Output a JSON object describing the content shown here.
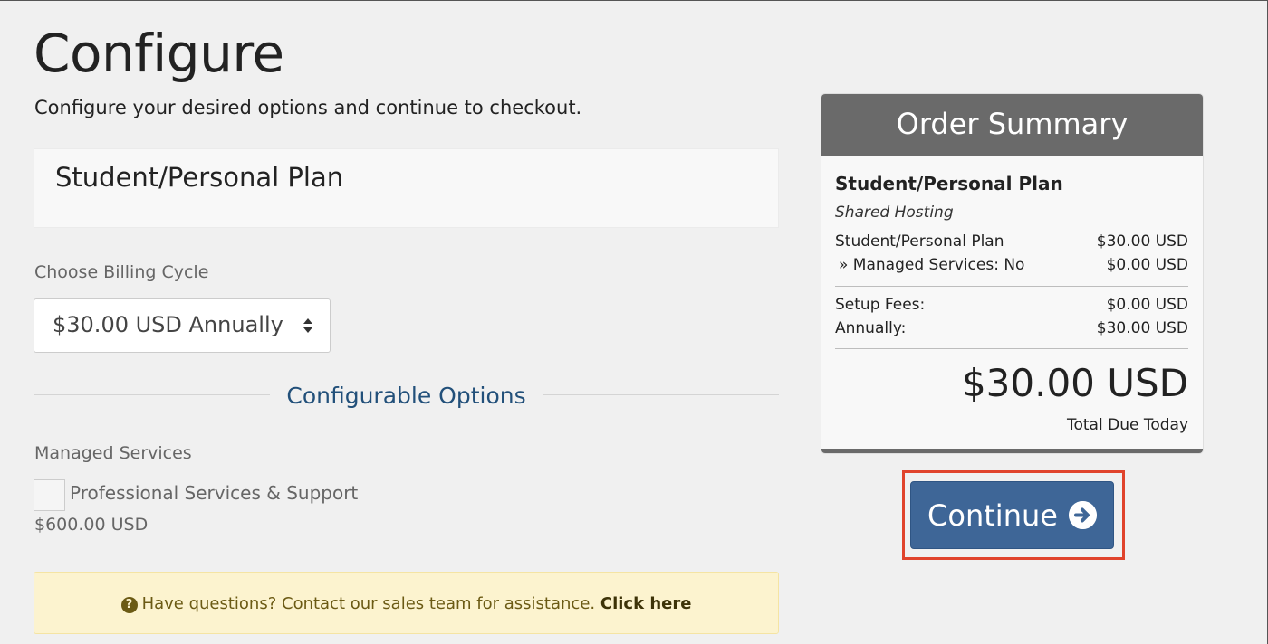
{
  "page": {
    "title": "Configure",
    "subtitle": "Configure your desired options and continue to checkout."
  },
  "product": {
    "name": "Student/Personal Plan"
  },
  "billing": {
    "label": "Choose Billing Cycle",
    "selected": "$30.00 USD Annually"
  },
  "configurable_options": {
    "title": "Configurable Options",
    "group_label": "Managed Services",
    "option_label": "Professional Services & Support",
    "option_checked": false,
    "option_price": "$600.00 USD"
  },
  "help": {
    "text": "Have questions? Contact our sales team for assistance.",
    "link": "Click here"
  },
  "summary": {
    "header": "Order Summary",
    "product_name": "Student/Personal Plan",
    "product_group": "Shared Hosting",
    "lines": [
      {
        "label": "Student/Personal Plan",
        "value": "$30.00 USD"
      },
      {
        "label": "» Managed Services: No",
        "value": "$0.00 USD"
      }
    ],
    "fees": [
      {
        "label": "Setup Fees:",
        "value": "$0.00 USD"
      },
      {
        "label": "Annually:",
        "value": "$30.00 USD"
      }
    ],
    "total": "$30.00 USD",
    "total_label": "Total Due Today"
  },
  "actions": {
    "continue_label": "Continue"
  },
  "colors": {
    "accent": "#3e6697",
    "link_blue": "#22507a",
    "summary_header": "#6a6a6a",
    "alert_bg": "#fcf3cf",
    "highlight": "#e0432c"
  }
}
